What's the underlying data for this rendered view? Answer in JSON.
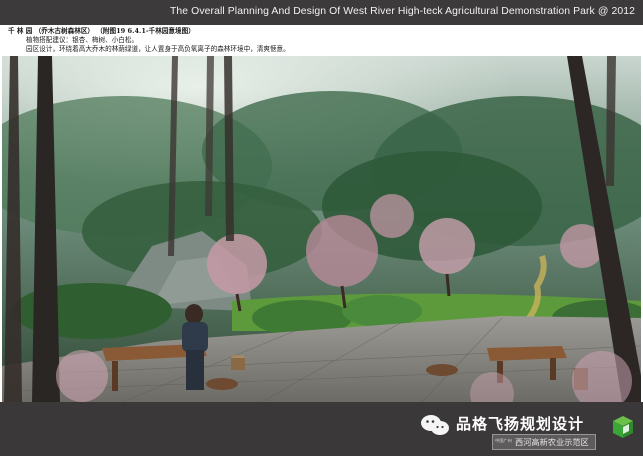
{
  "header": {
    "title": "The Overall Planning And Design Of  West River High-teck Agricultural Demonstration Park @ 2012"
  },
  "description": {
    "line1": "千 林 园 （乔木古树森林区） （附图19  6.4.1-千林园意境图）",
    "line2": "植物搭配建议：银杏、梅树、小白松。",
    "line3": "园区设计，环绕着高大乔木的林荫绿道，让人置身于高负氧离子的森林环境中，清爽惬意。"
  },
  "watermark": {
    "brand": "品格飞扬规划设计",
    "sub_prefix": "中国广州",
    "sub_text": "西河高新农业示范区",
    "icons": [
      "wechat-icon",
      "cube-logo-icon"
    ]
  },
  "colors": {
    "bars": "#3b3839",
    "bar_text": "#f2f2f2",
    "cube_green": "#3aa63a"
  }
}
